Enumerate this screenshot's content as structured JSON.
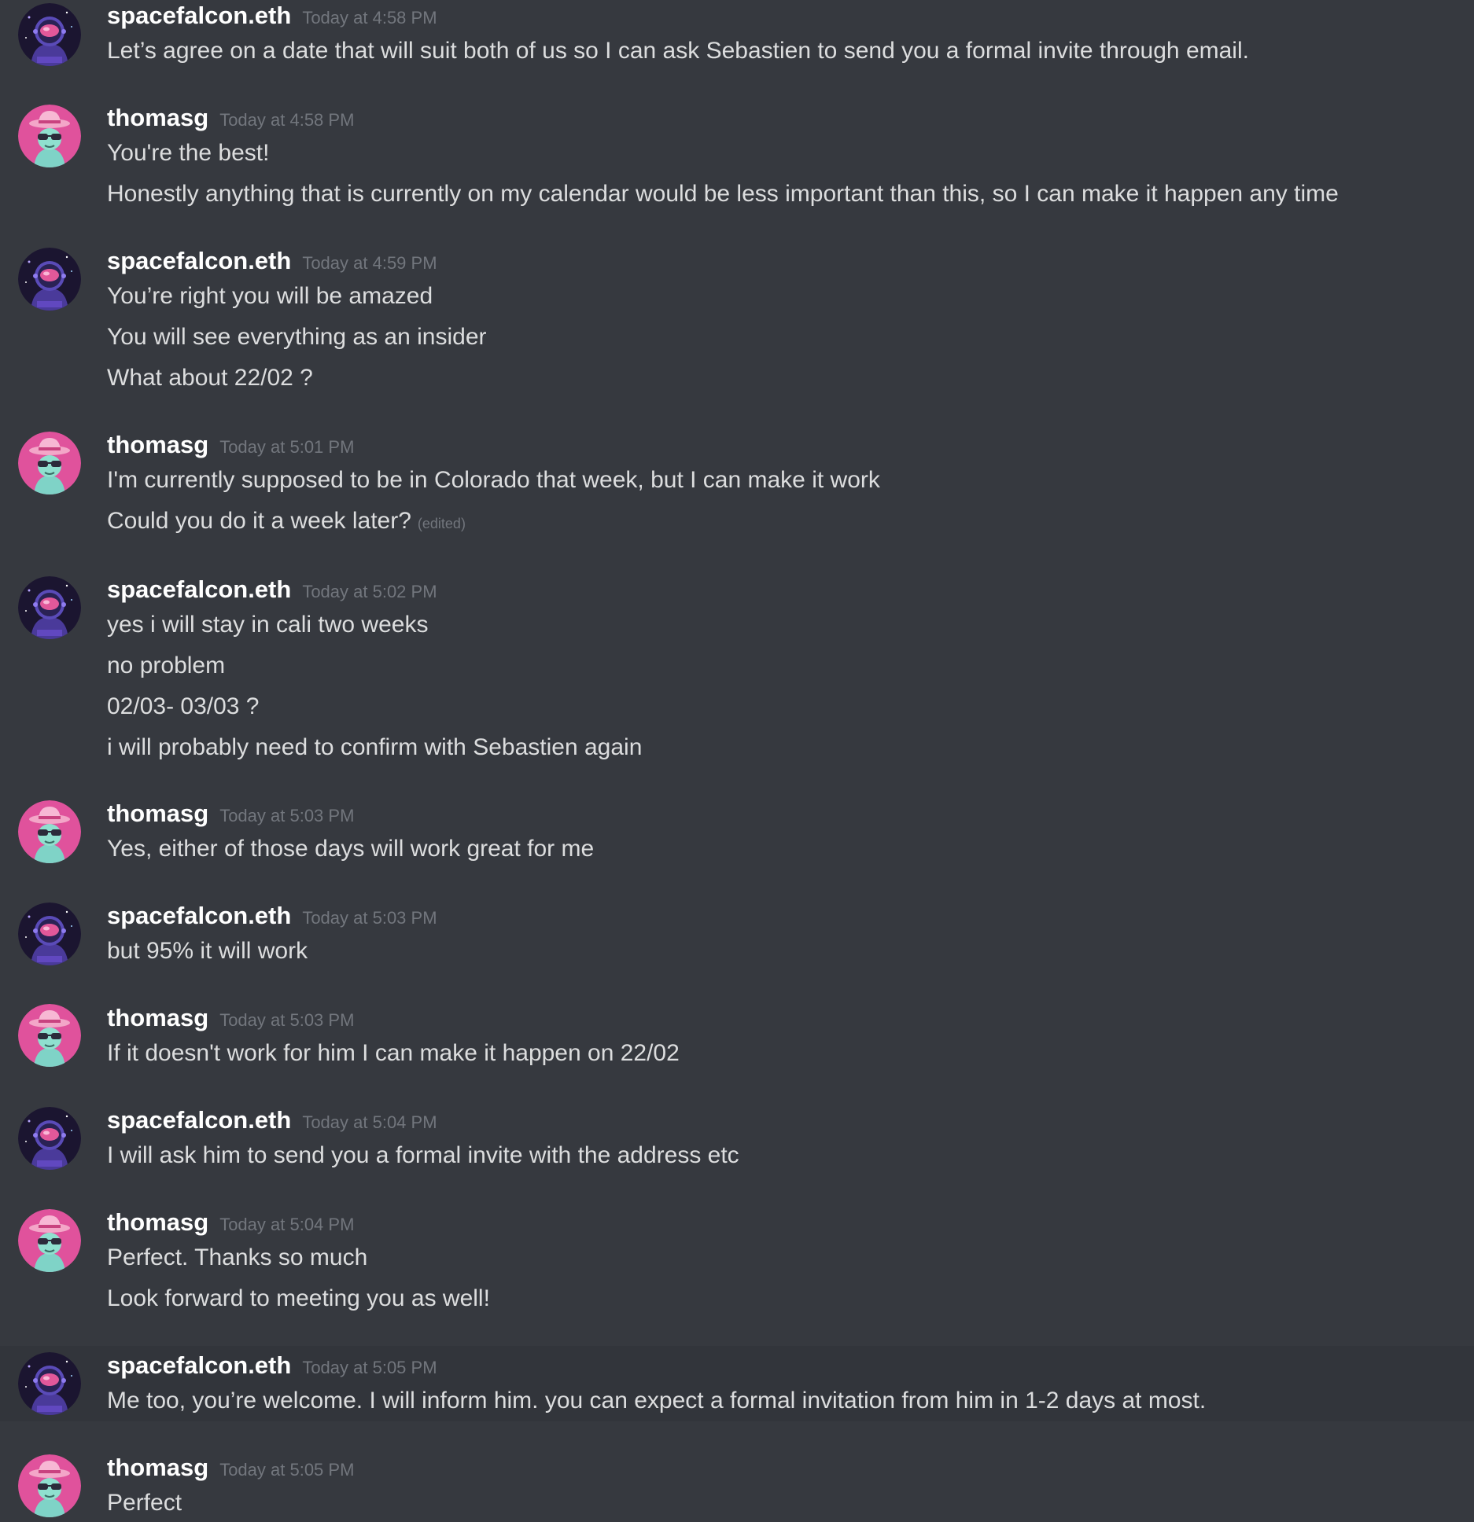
{
  "colors": {
    "background": "#36393f",
    "hover_background": "#32353b",
    "username": "#ffffff",
    "timestamp": "#72767d",
    "message_text": "#dcddde",
    "spacefalcon_avatar": "#1b1530",
    "thomasg_avatar": "#e0529c"
  },
  "users": {
    "spacefalcon": {
      "name": "spacefalcon.eth",
      "avatar_icon": "astronaut-avatar-icon"
    },
    "thomasg": {
      "name": "thomasg",
      "avatar_icon": "hat-sunglasses-avatar-icon"
    }
  },
  "edited_label": "(edited)",
  "messages": [
    {
      "author": "spacefalcon.eth",
      "time": "Today at 4:58 PM",
      "lines": [
        "Let’s agree on a date that will suit both of us so I can ask Sebastien to send you a formal invite through email."
      ]
    },
    {
      "author": "thomasg",
      "time": "Today at 4:58 PM",
      "lines": [
        "You're the best!",
        "Honestly anything that is currently on my calendar would be less important than this, so I can make it happen any time"
      ]
    },
    {
      "author": "spacefalcon.eth",
      "time": "Today at 4:59 PM",
      "lines": [
        "You’re right you will be amazed",
        "You will see everything as an insider",
        "What about 22/02 ?"
      ]
    },
    {
      "author": "thomasg",
      "time": "Today at 5:01 PM",
      "lines": [
        "I'm currently supposed to be in Colorado that week, but I can make it work",
        "Could you do it a week later?"
      ]
    },
    {
      "author": "spacefalcon.eth",
      "time": "Today at 5:02 PM",
      "lines": [
        "yes i will stay in cali two weeks",
        "no problem",
        "02/03- 03/03 ?",
        "i will probably need to confirm with Sebastien again"
      ]
    },
    {
      "author": "thomasg",
      "time": "Today at 5:03 PM",
      "lines": [
        "Yes, either of those days will work great for me"
      ]
    },
    {
      "author": "spacefalcon.eth",
      "time": "Today at 5:03 PM",
      "lines": [
        "but 95% it will work"
      ]
    },
    {
      "author": "thomasg",
      "time": "Today at 5:03 PM",
      "lines": [
        "If it doesn't work for him I can make it happen on 22/02"
      ]
    },
    {
      "author": "spacefalcon.eth",
      "time": "Today at 5:04 PM",
      "lines": [
        "I will ask him to send you a formal invite with the address etc"
      ]
    },
    {
      "author": "thomasg",
      "time": "Today at 5:04 PM",
      "lines": [
        "Perfect. Thanks so much",
        "Look forward to meeting you as well!"
      ]
    },
    {
      "author": "spacefalcon.eth",
      "time": "Today at 5:05 PM",
      "lines": [
        "Me too, you’re welcome. I will inform him. you can expect a formal invitation from him in 1-2 days at most."
      ]
    },
    {
      "author": "thomasg",
      "time": "Today at 5:05 PM",
      "lines": [
        "Perfect"
      ]
    }
  ]
}
